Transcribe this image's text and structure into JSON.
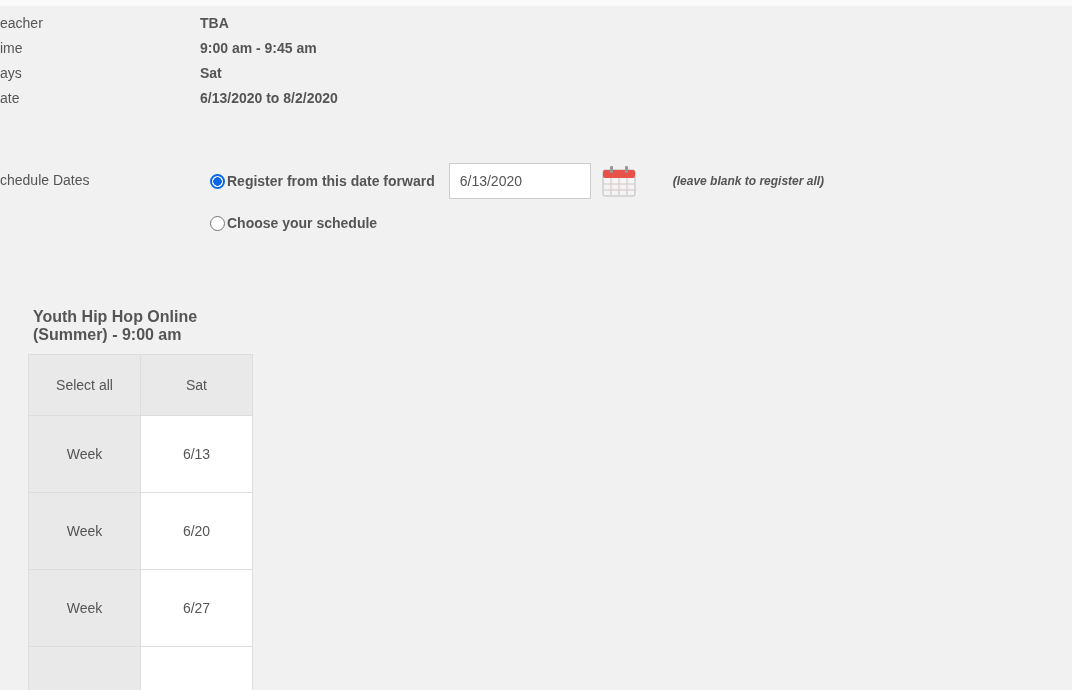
{
  "details": [
    {
      "label": "eacher",
      "value": "TBA"
    },
    {
      "label": "ime",
      "value": "9:00 am - 9:45 am"
    },
    {
      "label": "ays",
      "value": "Sat"
    },
    {
      "label": "ate",
      "value": "6/13/2020 to 8/2/2020"
    }
  ],
  "schedule": {
    "label": "chedule Dates",
    "options": [
      {
        "label": "Register from this date forward",
        "selected": true
      },
      {
        "label": "Choose your schedule",
        "selected": false
      }
    ],
    "date_field": {
      "value": "6/13/2020"
    },
    "hint": "(leave blank to register all)"
  },
  "class_title": "Youth Hip Hop Online (Summer) - 9:00 am",
  "table": {
    "columns": [
      "Select all",
      "Sat"
    ],
    "rows": [
      {
        "label": "Week",
        "date": "6/13"
      },
      {
        "label": "Week",
        "date": "6/20"
      },
      {
        "label": "Week",
        "date": "6/27"
      }
    ]
  }
}
